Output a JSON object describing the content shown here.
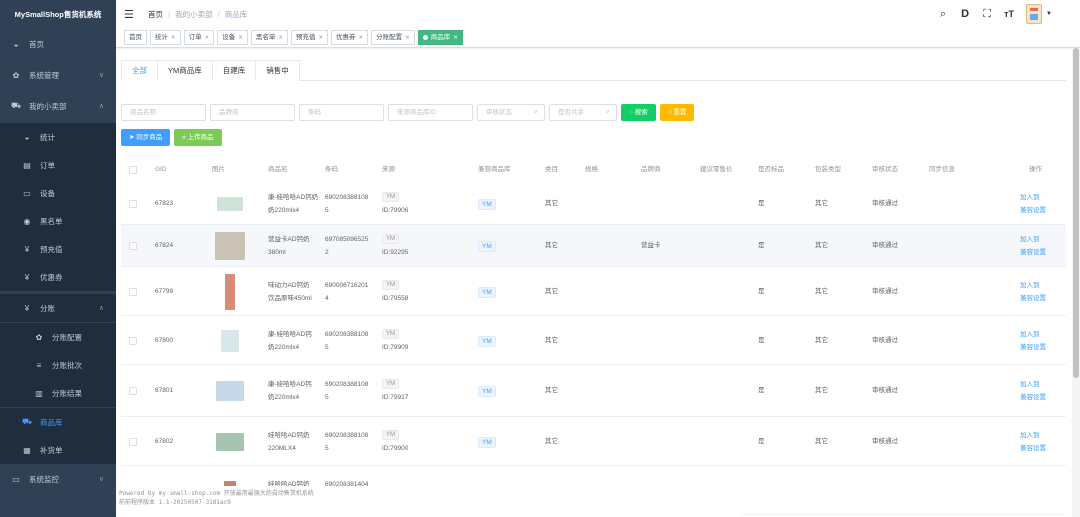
{
  "app": {
    "brand": "MySmallShop售货机系统"
  },
  "sidebar": {
    "items": [
      {
        "label": "首页",
        "icon": "dashboard-icon"
      },
      {
        "label": "系统管理",
        "icon": "gear-icon"
      },
      {
        "label": "我的小卖部",
        "icon": "cart-icon"
      },
      {
        "label": "统计",
        "icon": "dashboard-icon"
      },
      {
        "label": "订单",
        "icon": "document-icon"
      },
      {
        "label": "设备",
        "icon": "monitor-icon"
      },
      {
        "label": "黑名单",
        "icon": "ban-icon"
      },
      {
        "label": "预充值",
        "icon": "yen-icon"
      },
      {
        "label": "优惠券",
        "icon": "yen-icon"
      },
      {
        "label": "分账",
        "icon": "yen-icon"
      },
      {
        "label": "分账配置",
        "icon": "gear-icon"
      },
      {
        "label": "分账批次",
        "icon": "list-icon"
      },
      {
        "label": "分账结果",
        "icon": "bar-chart-icon"
      },
      {
        "label": "商品库",
        "icon": "cart-icon"
      },
      {
        "label": "补货单",
        "icon": "grid-icon"
      },
      {
        "label": "系统监控",
        "icon": "monitor-icon"
      }
    ]
  },
  "header": {
    "breadcrumb": [
      "首页",
      "我的小卖部",
      "商品库"
    ]
  },
  "tags_view": {
    "tags": [
      "首页",
      "统计",
      "订单",
      "设备",
      "黑名单",
      "预充值",
      "优惠券",
      "分账配置",
      "商品库"
    ]
  },
  "tabs": [
    "全部",
    "YM商品库",
    "自建库",
    "销售中"
  ],
  "filters": {
    "product_name": "商品名称",
    "brand": "品牌商",
    "barcode": "条码",
    "source_id": "来源商品库ID",
    "audit_status": "审核状态",
    "shared": "是否共享",
    "search": "搜索",
    "reset": "重置"
  },
  "actions": {
    "sync": "同步商品",
    "upload": "上传商品"
  },
  "table": {
    "columns": [
      "GID",
      "图片",
      "商品名",
      "条码",
      "来源",
      "兼容商品库",
      "类目",
      "规格",
      "品牌商",
      "建议零售价",
      "是否标品",
      "包装类型",
      "审核状态",
      "同步信息",
      "操作"
    ],
    "rows": [
      {
        "gid": "67823",
        "name1": "康-娃哈哈AD钙奶",
        "name2": "奶220mlx4",
        "bar1": "690208388108",
        "bar2": "5",
        "src": "YM",
        "id": "ID:79906",
        "compat": "YM",
        "cat": "其它",
        "brand": "",
        "std": "是",
        "pkg": "其它",
        "audit": "审核通过",
        "act1": "加入到",
        "act2": "兼容设置"
      },
      {
        "gid": "67824",
        "name1": "营益卡AD钙奶",
        "name2": "380ml",
        "bar1": "697085096525",
        "bar2": "2",
        "src": "YM",
        "id": "ID:92295",
        "compat": "YM",
        "cat": "其它",
        "brand": "营益卡",
        "std": "是",
        "pkg": "其它",
        "audit": "审核通过",
        "act1": "加入到",
        "act2": "兼容设置"
      },
      {
        "gid": "67799",
        "name1": "味动力AD钙奶",
        "name2": "饮品原味450ml",
        "bar1": "690006716201",
        "bar2": "4",
        "src": "YM",
        "id": "ID:79558",
        "compat": "YM",
        "cat": "其它",
        "brand": "",
        "std": "是",
        "pkg": "其它",
        "audit": "审核通过",
        "act1": "加入到",
        "act2": "兼容设置"
      },
      {
        "gid": "67800",
        "name1": "康-娃哈哈AD钙",
        "name2": "奶220mlx4",
        "bar1": "690208388108",
        "bar2": "5",
        "src": "YM",
        "id": "ID:79909",
        "compat": "YM",
        "cat": "其它",
        "brand": "",
        "std": "是",
        "pkg": "其它",
        "audit": "审核通过",
        "act1": "加入到",
        "act2": "兼容设置"
      },
      {
        "gid": "67801",
        "name1": "康-娃哈哈AD钙",
        "name2": "奶220mlx4",
        "bar1": "690208388108",
        "bar2": "5",
        "src": "YM",
        "id": "ID:79917",
        "compat": "YM",
        "cat": "其它",
        "brand": "",
        "std": "是",
        "pkg": "其它",
        "audit": "审核通过",
        "act1": "加入到",
        "act2": "兼容设置"
      },
      {
        "gid": "67802",
        "name1": "娃哈哈AD钙奶",
        "name2": "220MLX4",
        "bar1": "690208388108",
        "bar2": "5",
        "src": "YM",
        "id": "ID:79900",
        "compat": "YM",
        "cat": "其它",
        "brand": "",
        "std": "是",
        "pkg": "其它",
        "audit": "审核通过",
        "act1": "加入到",
        "act2": "兼容设置"
      },
      {
        "gid": "",
        "name1": "娃哈哈AD钙奶",
        "name2": "",
        "bar1": "690208381404",
        "bar2": "",
        "src": "",
        "id": "",
        "compat": "",
        "cat": "",
        "brand": "",
        "std": "",
        "pkg": "",
        "audit": "",
        "act1": "",
        "act2": ""
      }
    ]
  },
  "footer": {
    "line1": "Powered by my-small-shop.com 开放最用最强大的自动售货机系统",
    "line2": "前前程序版本 1.1-20250507-3181ac9"
  },
  "colors": {
    "sidebar_bg": "#304156",
    "sidebar_sub_bg": "#1f2d3d",
    "primary": "#409eff",
    "success": "#13ce66",
    "warning": "#ffba00",
    "tag_active": "#42b983"
  }
}
